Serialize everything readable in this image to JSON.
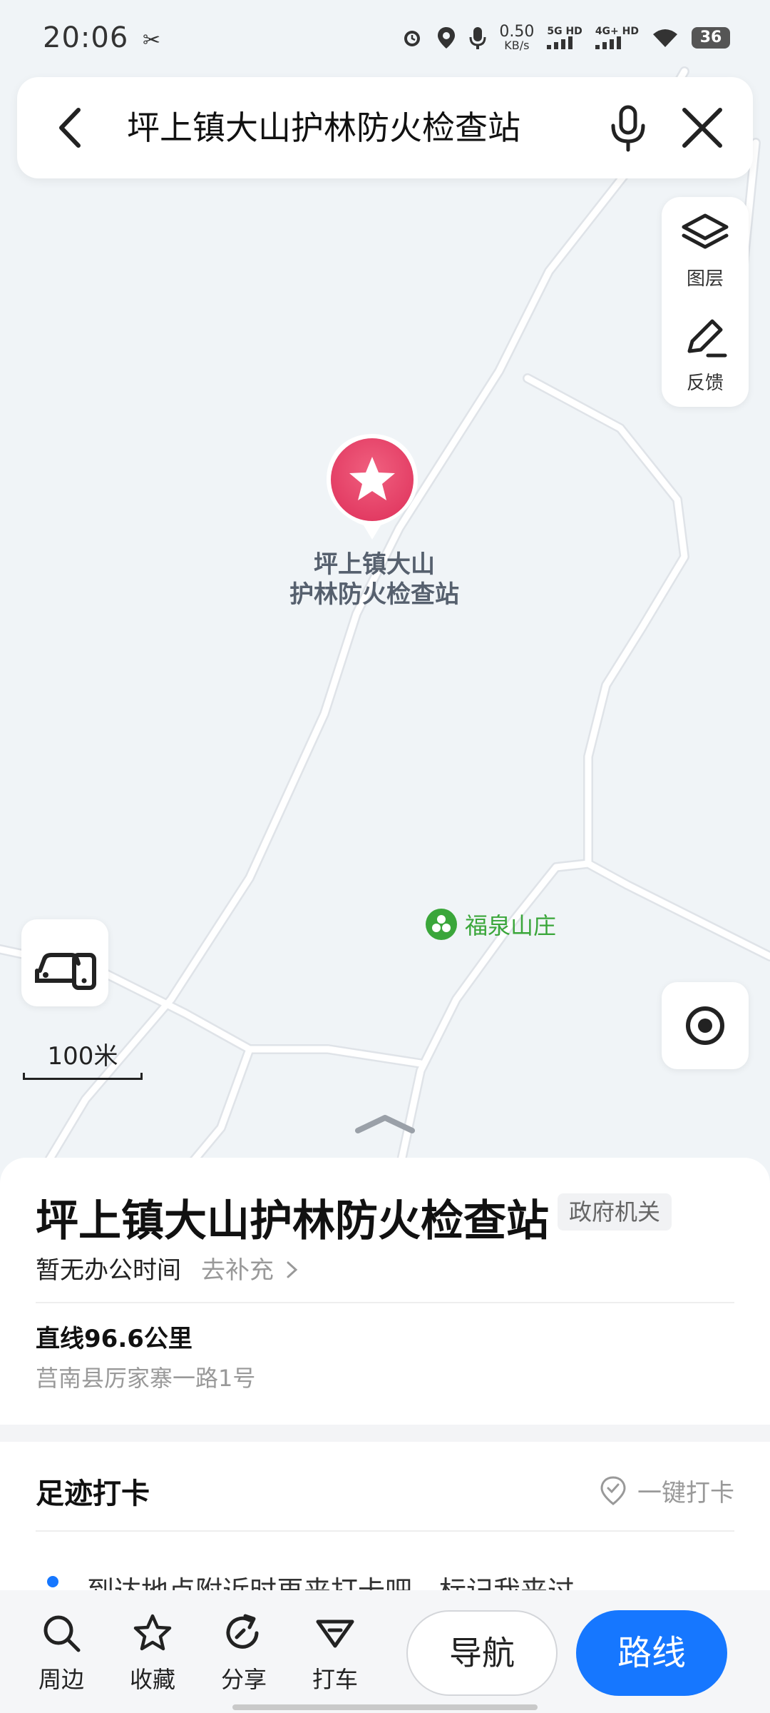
{
  "status_bar": {
    "time": "20:06",
    "net_speed": "0.50",
    "net_unit": "KB/s",
    "sig1": "5G HD",
    "sig2": "4G+ HD",
    "battery": "36"
  },
  "search": {
    "query": "坪上镇大山护林防火检查站"
  },
  "side_panel": {
    "layers_label": "图层",
    "feedback_label": "反馈"
  },
  "map": {
    "pin_label": "坪上镇大山护林防火检查站",
    "poi_label": "福泉山庄",
    "scale_label": "100米"
  },
  "place": {
    "title": "坪上镇大山护林防火检查站",
    "tag": "政府机关",
    "hours": "暂无办公时间",
    "hours_add": "去补充",
    "distance": "直线96.6公里",
    "address": "莒南县厉家寨一路1号"
  },
  "footprint": {
    "title": "足迹打卡",
    "checkin_label": "一键打卡",
    "tip": "到达地点附近时再来打卡吧，标记我来过"
  },
  "bottom_bar": {
    "tabs": [
      {
        "label": "周边",
        "icon": "search-icon"
      },
      {
        "label": "收藏",
        "icon": "star-icon"
      },
      {
        "label": "分享",
        "icon": "share-icon"
      },
      {
        "label": "打车",
        "icon": "taxi-icon"
      }
    ],
    "nav_label": "导航",
    "route_label": "路线"
  },
  "colors": {
    "pin": "#e8466a",
    "accent": "#1677ff",
    "poi": "#3aa63a"
  }
}
